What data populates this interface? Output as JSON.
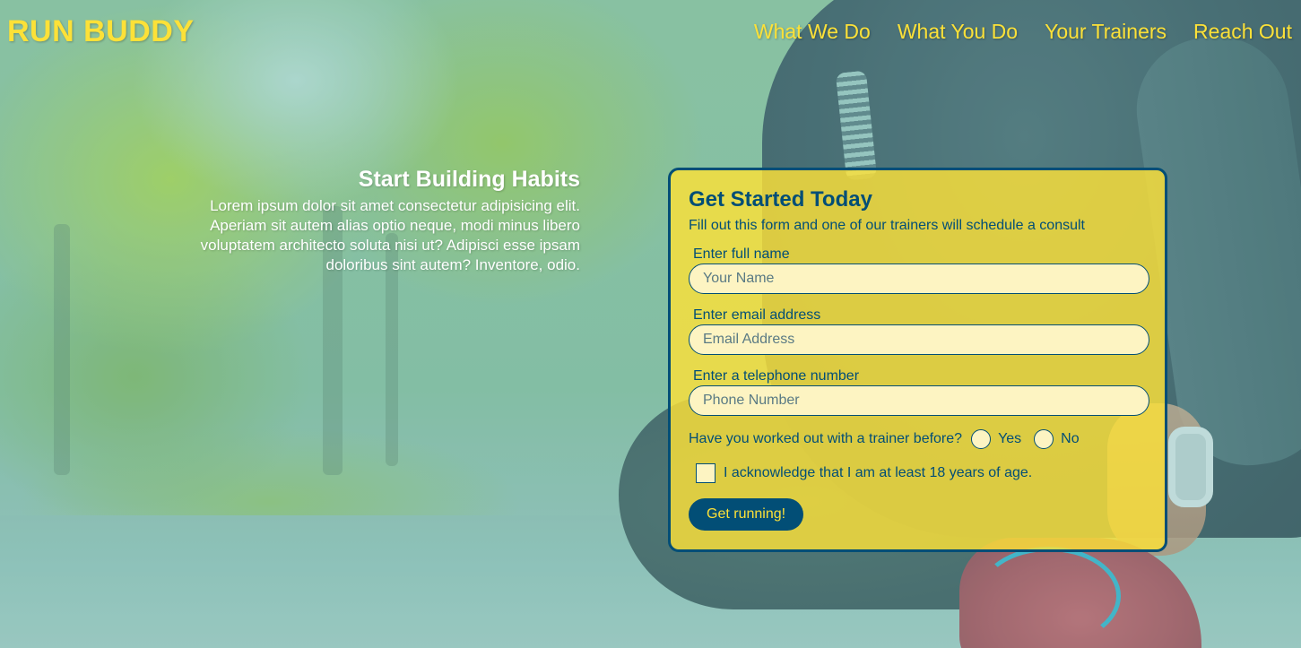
{
  "header": {
    "logo": "RUN BUDDY",
    "nav": [
      "What We Do",
      "What You Do",
      "Your Trainers",
      "Reach Out"
    ]
  },
  "hero": {
    "title": "Start Building Habits",
    "text": "Lorem ipsum dolor sit amet consectetur adipisicing elit. Aperiam sit autem alias optio neque, modi minus libero voluptatem architecto soluta nisi ut? Adipisci esse ipsam doloribus sint autem? Inventore, odio."
  },
  "form": {
    "title": "Get Started Today",
    "subtitle": "Fill out this form and one of our trainers will schedule a consult",
    "name_label": "Enter full name",
    "name_placeholder": "Your Name",
    "email_label": "Enter email address",
    "email_placeholder": "Email Address",
    "phone_label": "Enter a telephone number",
    "phone_placeholder": "Phone Number",
    "trainer_question": "Have you worked out with a trainer before?",
    "yes_label": "Yes",
    "no_label": "No",
    "age_ack": "I acknowledge that I am at least 18 years of age.",
    "submit_label": "Get running!"
  },
  "colors": {
    "brand_yellow": "#fce138",
    "brand_blue": "#024e76"
  }
}
